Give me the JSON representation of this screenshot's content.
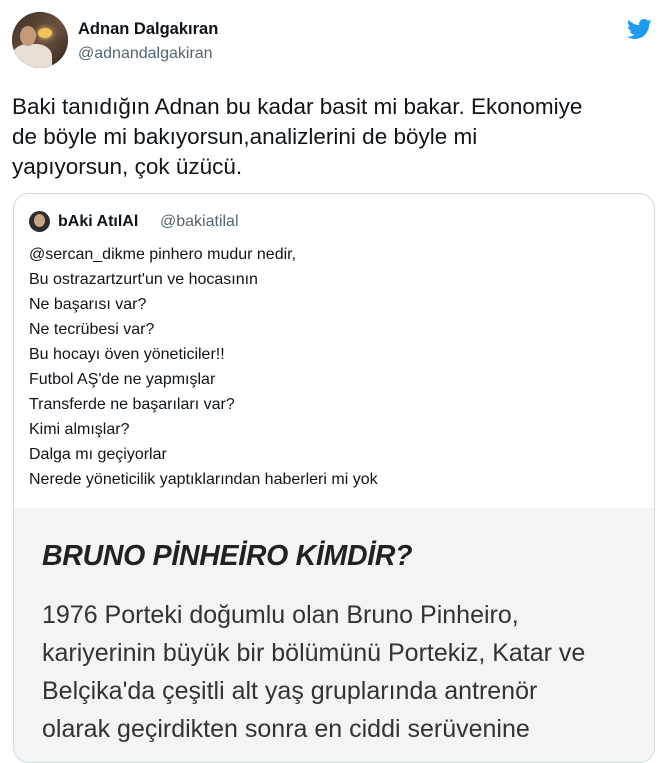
{
  "author": {
    "name": "Adnan Dalgakıran",
    "handle": "@adnandalgakiran"
  },
  "icons": {
    "brand": "twitter-bird-icon",
    "brand_color": "#1d9bf0"
  },
  "tweet": {
    "lines": [
      "Baki tanıdığın Adnan bu kadar basit mi bakar. Ekonomiye",
      "de böyle mi bakıyorsun,analizlerini de böyle mi",
      "yapıyorsun, çok üzücü."
    ]
  },
  "quoted": {
    "name": "bAki AtılAl",
    "handle": "@bakiatilal",
    "lines": [
      "@sercan_dikme pinhero mudur nedir,",
      "Bu ostrazartzurt'un ve hocasının",
      "Ne başarısı var?",
      "Ne tecrübesi var?",
      "Bu hocayı öven yöneticiler!!",
      "Futbol AŞ'de ne yapmışlar",
      "Transferde ne başarıları var?",
      "Kimi almışlar?",
      "Dalga mı geçiyorlar",
      "Nerede yöneticilik yaptıklarından haberleri mi yok"
    ],
    "image": {
      "title": "BRUNO PİNHEİRO KİMDİR?",
      "body_lines": [
        "1976 Porteki doğumlu olan Bruno Pinheiro,",
        "kariyerinin büyük bir bölümünü Portekiz, Katar ve",
        "Belçika'da çeşitli alt yaş gruplarında antrenör",
        "olarak geçirdikten sonra en ciddi serüvenine"
      ]
    }
  }
}
